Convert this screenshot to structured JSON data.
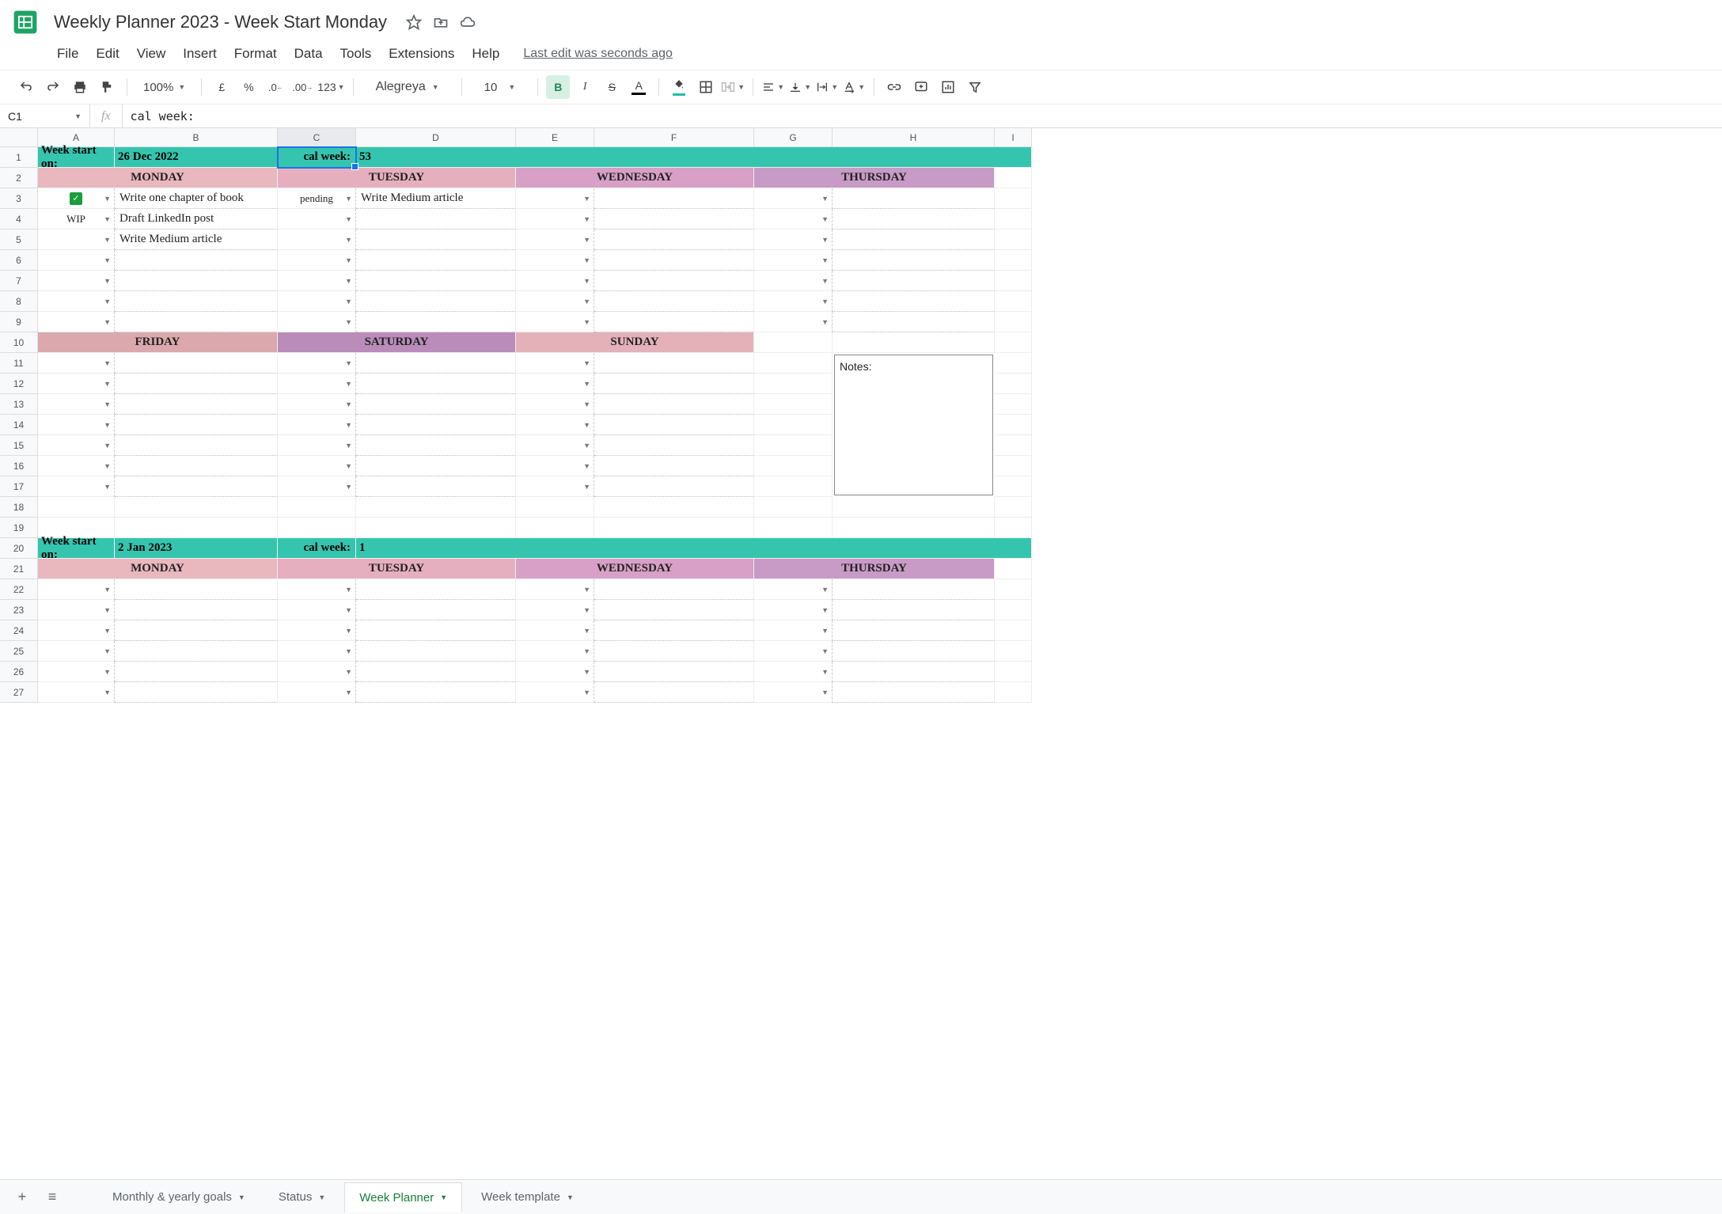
{
  "doc": {
    "title": "Weekly Planner 2023 - Week Start Monday"
  },
  "menus": [
    "File",
    "Edit",
    "View",
    "Insert",
    "Format",
    "Data",
    "Tools",
    "Extensions",
    "Help"
  ],
  "last_edit": "Last edit was seconds ago",
  "toolbar": {
    "zoom": "100%",
    "currency": "£",
    "percent": "%",
    "dec_minus": ".0",
    "dec_plus": ".00",
    "format123": "123",
    "font": "Alegreya",
    "font_size": "10",
    "bold": "B",
    "italic": "I",
    "strike": "S",
    "textcolor": "A"
  },
  "namebox": "C1",
  "fx_label": "fx",
  "fx_value": "cal week:",
  "columns": [
    "A",
    "B",
    "C",
    "D",
    "E",
    "F",
    "G",
    "H",
    "I"
  ],
  "rows": [
    1,
    2,
    3,
    4,
    5,
    6,
    7,
    8,
    9,
    10,
    11,
    12,
    13,
    14,
    15,
    16,
    17,
    18,
    19,
    20,
    21,
    22,
    23,
    24,
    25,
    26,
    27
  ],
  "week1": {
    "start_label": "Week start on:",
    "start_date": "26 Dec 2022",
    "cal_label": "cal week:",
    "cal_num": "53",
    "days_top": [
      "MONDAY",
      "TUESDAY",
      "WEDNESDAY",
      "THURSDAY"
    ],
    "days_bottom": [
      "FRIDAY",
      "SATURDAY",
      "SUNDAY"
    ],
    "monday_tasks": [
      {
        "status": "check",
        "text": "Write one chapter of book"
      },
      {
        "status": "WIP",
        "text": "Draft LinkedIn post"
      },
      {
        "status": "",
        "text": "Write Medium article"
      }
    ],
    "tuesday_tasks": [
      {
        "status": "pending",
        "text": "Write Medium article"
      }
    ],
    "notes_label": "Notes:"
  },
  "week2": {
    "start_label": "Week start on:",
    "start_date": "2 Jan 2023",
    "cal_label": "cal week:",
    "cal_num": "1",
    "days_top": [
      "MONDAY",
      "TUESDAY",
      "WEDNESDAY",
      "THURSDAY"
    ]
  },
  "sheets": {
    "tabs": [
      "Monthly & yearly goals",
      "Status",
      "Week Planner",
      "Week template"
    ],
    "active": 2
  }
}
